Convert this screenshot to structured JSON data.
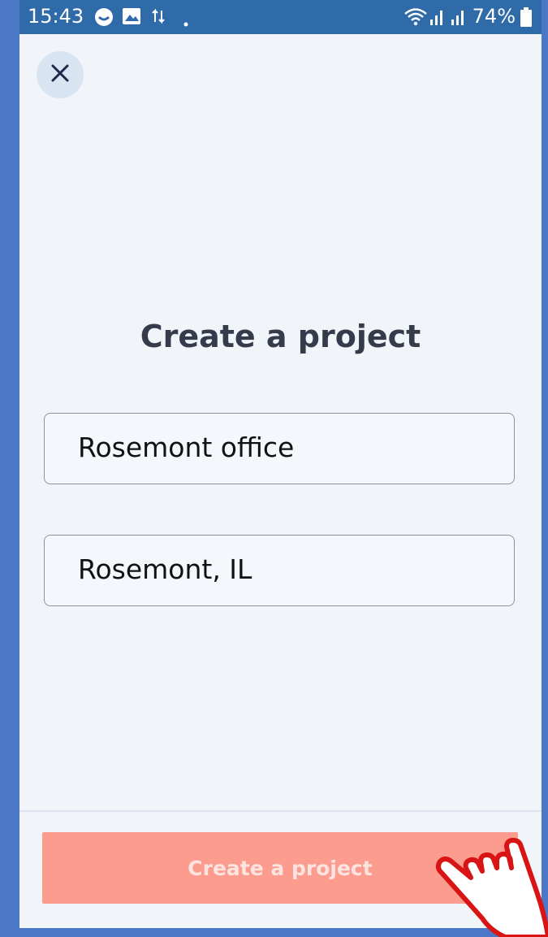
{
  "status_bar": {
    "time": "15:43",
    "battery": "74%",
    "icons": [
      "messenger-icon",
      "gallery-icon",
      "data-transfer-icon",
      "dot-icon",
      "wifi-icon",
      "signal-icon",
      "battery-icon"
    ]
  },
  "header": {
    "close_icon": "close-icon"
  },
  "main": {
    "title": "Create a project",
    "fields": [
      {
        "name": "project-name-field",
        "value": "Rosemont office"
      },
      {
        "name": "project-location-field",
        "value": "Rosemont, IL"
      }
    ]
  },
  "footer": {
    "submit_label": "Create a project"
  },
  "colors": {
    "status_bar": "#2f6aa9",
    "background": "#f1f5fa",
    "button": "#fb9c8f",
    "button_text": "#fde4e0",
    "title_text": "#363b4c",
    "pointer_outline": "#d81414"
  }
}
